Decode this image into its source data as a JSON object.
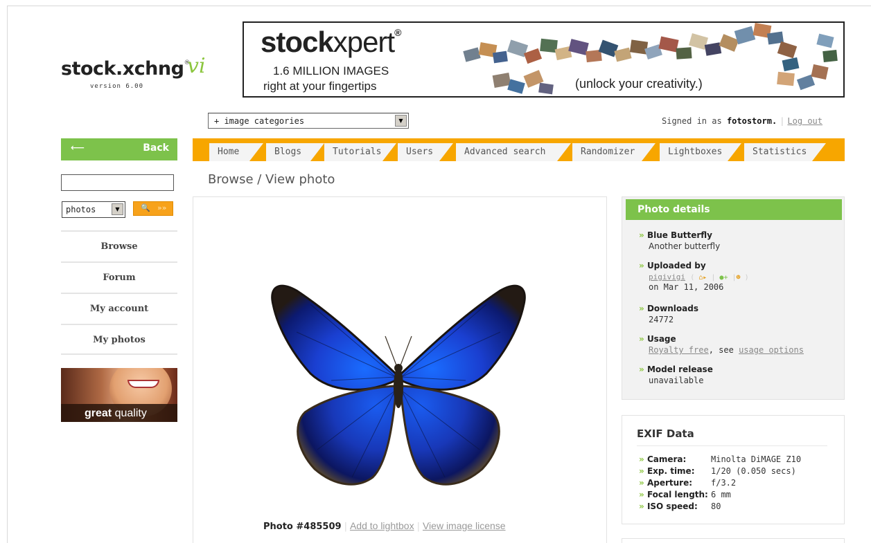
{
  "logo": {
    "main": "stock.xchng",
    "reg": "®",
    "vi": "vi",
    "version": "version 6.00"
  },
  "banner": {
    "brand_bold": "stock",
    "brand_light": "xpert",
    "brand_reg": "®",
    "line1": "1.6 MILLION IMAGES",
    "line2": "right at your fingertips",
    "tagline": "(unlock your creativity.)"
  },
  "category_select": {
    "value": "+ image categories"
  },
  "user": {
    "signed_in_prefix": "Signed in as",
    "username": "fotostorm.",
    "logout": "Log out"
  },
  "back": {
    "arrow": "⟵",
    "label": "Back"
  },
  "nav": {
    "tabs": [
      "Home",
      "Blogs",
      "Tutorials",
      "Users",
      "Advanced search",
      "Randomizer",
      "Lightboxes",
      "Statistics"
    ]
  },
  "page_title": "Browse / View photo",
  "sidebar": {
    "search_value": "",
    "type_select": "photos",
    "search_button_icon": "🔍",
    "search_button_chevrons": "»»",
    "menu": [
      "Browse",
      "Forum",
      "My account",
      "My photos"
    ],
    "promo_bold": "great",
    "promo_rest": " quality"
  },
  "photo": {
    "number": "Photo #485509",
    "add_lightbox": "Add to lightbox",
    "view_license": "View image license"
  },
  "details": {
    "title": "Photo details",
    "name_label": "Blue Butterfly",
    "name_desc": "Another butterfly",
    "uploaded_label": "Uploaded by",
    "uploader": "pigivigi",
    "uploaded_date": "on Mar 11, 2006",
    "downloads_label": "Downloads",
    "downloads": "24772",
    "usage_label": "Usage",
    "usage_link": "Royalty free",
    "usage_mid": ", see ",
    "usage_options": "usage options",
    "model_label": "Model release",
    "model_value": "unavailable"
  },
  "exif": {
    "title": "EXIF Data",
    "rows": [
      {
        "k": "Camera:",
        "v": "Minolta DiMAGE Z10"
      },
      {
        "k": "Exp. time:",
        "v": "1/20 (0.050 secs)"
      },
      {
        "k": "Aperture:",
        "v": "f/3.2"
      },
      {
        "k": "Focal length:",
        "v": "6 mm"
      },
      {
        "k": "ISO speed:",
        "v": "80"
      }
    ]
  },
  "colors": {
    "green": "#7dc24b",
    "orange": "#f7a600",
    "tab_bg": "#f4f4f4"
  }
}
